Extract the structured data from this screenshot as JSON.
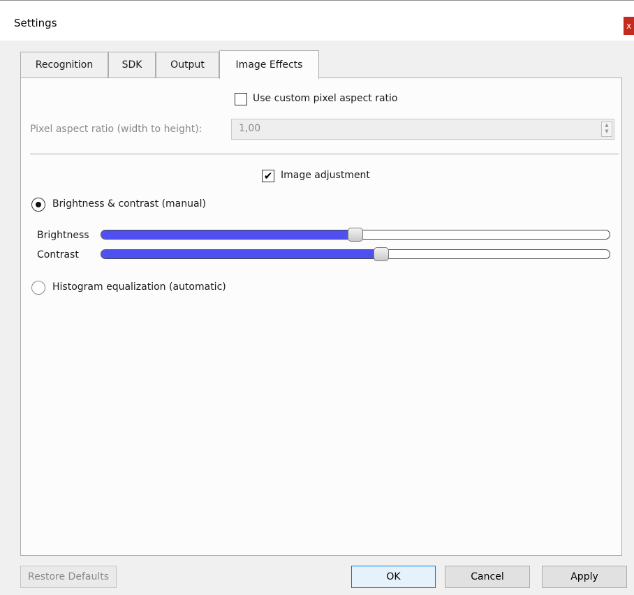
{
  "window": {
    "title": "Settings",
    "close_label": "x"
  },
  "tabs": [
    {
      "label": "Recognition"
    },
    {
      "label": "SDK"
    },
    {
      "label": "Output"
    },
    {
      "label": "Image Effects",
      "active": true
    }
  ],
  "image_effects": {
    "custom_aspect": {
      "label": "Use custom pixel aspect ratio",
      "checked": false
    },
    "pixel_aspect": {
      "label": "Pixel aspect ratio (width to height):",
      "value": "1,00",
      "enabled": false
    },
    "image_adjustment": {
      "label": "Image adjustment",
      "checked": true,
      "check_glyph": "✔"
    },
    "brightness_contrast": {
      "label": "Brightness & contrast (manual)",
      "selected": true
    },
    "brightness": {
      "label": "Brightness",
      "level_percent": 50
    },
    "contrast": {
      "label": "Contrast",
      "level_percent": 55
    },
    "histogram": {
      "label": "Histogram equalization (automatic)",
      "selected": false
    }
  },
  "buttons": {
    "restore_defaults": "Restore Defaults",
    "ok": "OK",
    "cancel": "Cancel",
    "apply": "Apply"
  },
  "colors": {
    "slider_fill": "#5050f0",
    "close_button": "#c42b1c",
    "default_button_border": "#0078d7"
  }
}
